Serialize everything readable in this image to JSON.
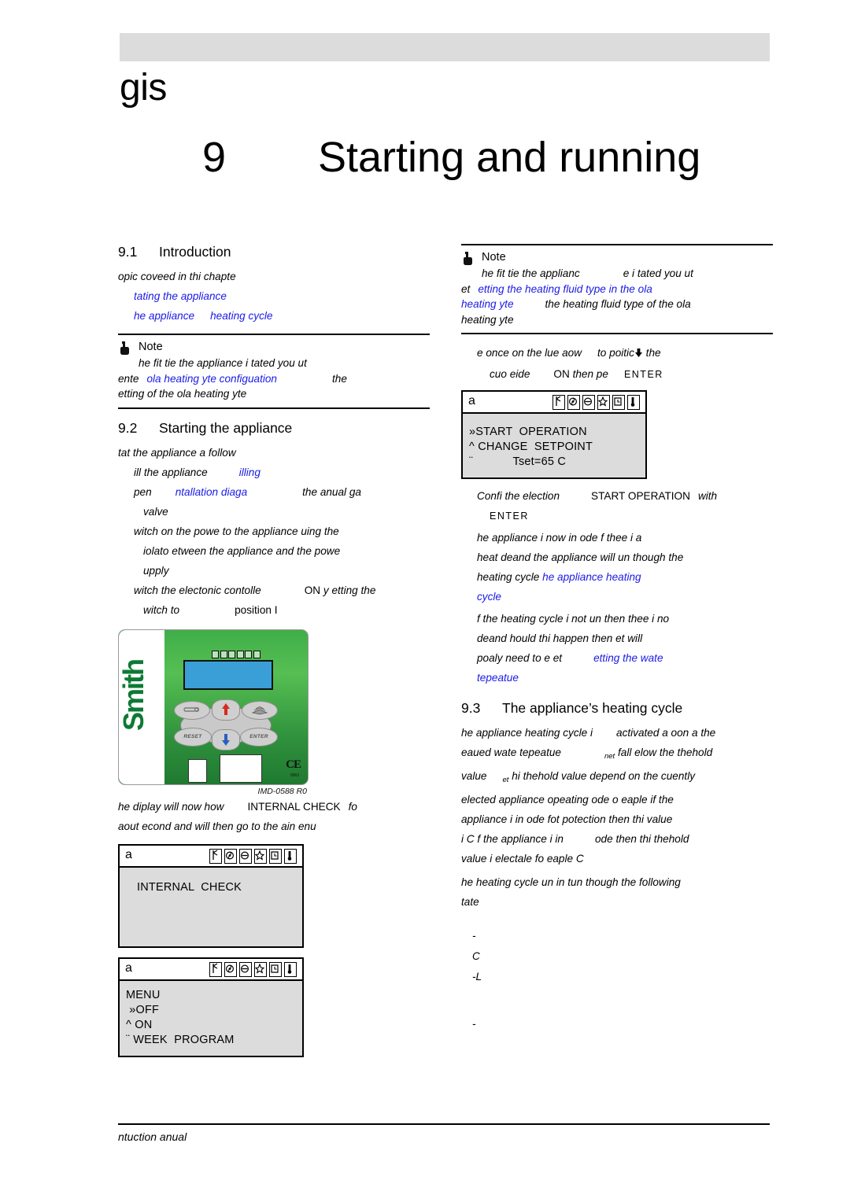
{
  "header": {
    "brand": "gis",
    "chapter_number": "9",
    "chapter_title": "Starting and running"
  },
  "left_column": {
    "s91": {
      "num": "9.1",
      "title": "Introduction",
      "intro": "opic coveed in thi chapte",
      "bullets": [
        "tating the appliance",
        "he appliance",
        "heating cycle"
      ],
      "note": {
        "title": "Note",
        "line1": "he fit tie the appliance i tated you ut",
        "line2_a": "ente",
        "line2_link": "ola heating yte configuation",
        "line2_b": "the",
        "line3": "etting of the ola heating yte"
      }
    },
    "s92": {
      "num": "9.2",
      "title": "Starting the appliance",
      "intro": "tat the appliance a follow",
      "step1_a": "ill the appliance",
      "step1_link": "illing",
      "step2_a": "pen",
      "step2_link": "ntallation diaga",
      "step2_b": "the anual ga",
      "step2_c": "valve",
      "step3_l1": "witch on the powe to the appliance uing the",
      "step3_l2": "iolato etween the appliance and the powe",
      "step3_l3": "upply",
      "step4_a": "witch the electonic contolle",
      "step4_on": "ON",
      "step4_b": "y etting the",
      "step4_c": "witch to",
      "step4_d": "position I"
    },
    "figure": {
      "brand_logo": "Smith",
      "keys": {
        "reset": "RESET",
        "enter": "ENTER",
        "service": "wrench-key",
        "up": "up-arrow-key",
        "down": "down-arrow-key",
        "menu": "book-key"
      },
      "ce_mark": "CE",
      "ce_number": "0063",
      "caption": "IMD-0588 R0"
    },
    "after_figure": {
      "l1_a": "he diplay will now how",
      "l1_mono": "INTERNAL  CHECK",
      "l1_b": "fo",
      "l2": "aout  econd and will then go to the ain enu"
    },
    "lcd1": {
      "tag": "a",
      "lines": [
        "INTERNAL  CHECK"
      ]
    },
    "lcd2": {
      "tag": "a",
      "lines": [
        "MENU",
        " »OFF",
        "^ ON",
        "¨ WEEK  PROGRAM"
      ]
    }
  },
  "right_column": {
    "note": {
      "title": "Note",
      "line1_a": "he fit tie the applianc",
      "line1_b": "e i tated you ut",
      "line2_a": "et",
      "line2_link": "etting the heating fluid type in the ola",
      "line3_link": "heating yte",
      "line3_b": "the heating fluid type of the ola",
      "line4": "heating yte"
    },
    "step_blue": {
      "l1_a": "e once on the lue aow",
      "l1_b": "to poitic",
      "l1_c": "the",
      "l2_a": "cuo eide",
      "l2_on": "ON",
      "l2_b": "then pe",
      "l2_enter": "ENTER"
    },
    "lcd3": {
      "tag": "a",
      "lines": [
        "»START  OPERATION",
        "^ CHANGE  SETPOINT",
        "¨            Tset=65 C"
      ]
    },
    "confirm": {
      "l1_a": "Confi the election",
      "l1_mono": "START  OPERATION",
      "l1_b": "with",
      "l2_enter": "ENTER"
    },
    "para2": {
      "l1": "he appliance i now in  ode f thee i a",
      "l2": "heat deand the appliance will un though the",
      "l3_a": "heating cycle",
      "l3_link": "he appliance heating",
      "l4_link": "cycle"
    },
    "para3": {
      "l1": "f the heating cycle i not un then thee i no",
      "l2": "deand hould thi happen then et will",
      "l3_a": "poaly need to e et",
      "l3_link": "etting the wate",
      "l4_link": "tepeatue"
    },
    "s93": {
      "num": "9.3",
      "title": "The appliance’s heating cycle",
      "l1_a": "he appliance heating cycle i",
      "l1_b": "activated a oon a the",
      "l2_a": "eaued wate tepeatue",
      "l2_sub": "net",
      "l2_b": "fall elow the thehold",
      "l3_a": "value",
      "l3_sub": "et",
      "l3_b": "hi thehold value depend on the cuently",
      "l4": "elected appliance opeating ode o eaple if the",
      "l5": "appliance i in  ode fot potection then thi value",
      "l6_a": "i C f the appliance i in",
      "l6_b": "ode then thi thehold",
      "l7": "value i electale fo eaple C",
      "p2_l1": "he heating cycle un in tun though the following",
      "p2_l2": "tate"
    },
    "dash_items": [
      "-",
      " C",
      "-L",
      "-"
    ]
  },
  "footer": {
    "text": "ntuction anual"
  }
}
